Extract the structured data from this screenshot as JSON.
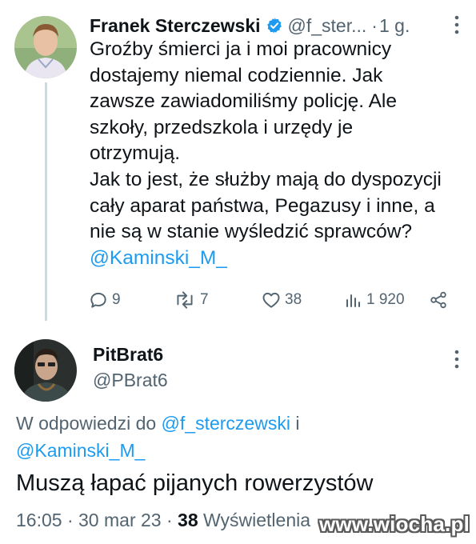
{
  "tweet1": {
    "author_name": "Franek Sterczewski",
    "handle": "@f_ster...",
    "separator": "·",
    "time": "1 g.",
    "text": "Groźby śmierci ja i moi pracownicy\ndostajemy niemal codziennie. Jak\nzawsze zawiadomiliśmy policję. Ale\nszkoły, przedszkola i urzędy je\notrzymują.\nJak to jest, że służby mają do dyspozycji\ncały aparat państwa, Pegazusy i inne, a\nnie są w stanie wyśledzić sprawców?",
    "mention": "@Kaminski_M_",
    "actions": {
      "replies": "9",
      "retweets": "7",
      "likes": "38",
      "views": "1 920"
    },
    "icons": {
      "verified": "verified-badge-icon",
      "reply": "comment-icon",
      "retweet": "retweet-icon",
      "like": "heart-icon",
      "views": "analytics-icon",
      "share": "share-icon",
      "more": "more-vertical-icon"
    }
  },
  "tweet2": {
    "author_name": "PitBrat6",
    "handle": "@PBrat6",
    "reply_prefix": "W odpowiedzi do",
    "reply_to_1": "@f_sterczewski",
    "reply_and": "i",
    "reply_to_2": "@Kaminski_M_",
    "text": "Muszą łapać pijanych rowerzystów",
    "time": "16:05",
    "date": "30 mar 23",
    "meta_sep": "·",
    "views_count": "38",
    "views_label": "Wyświetlenia"
  },
  "watermark": "www.wiocha.pl",
  "colors": {
    "link": "#1d9bf0",
    "muted": "#536471",
    "text": "#0f1419",
    "thread_line": "#cfd9de"
  }
}
